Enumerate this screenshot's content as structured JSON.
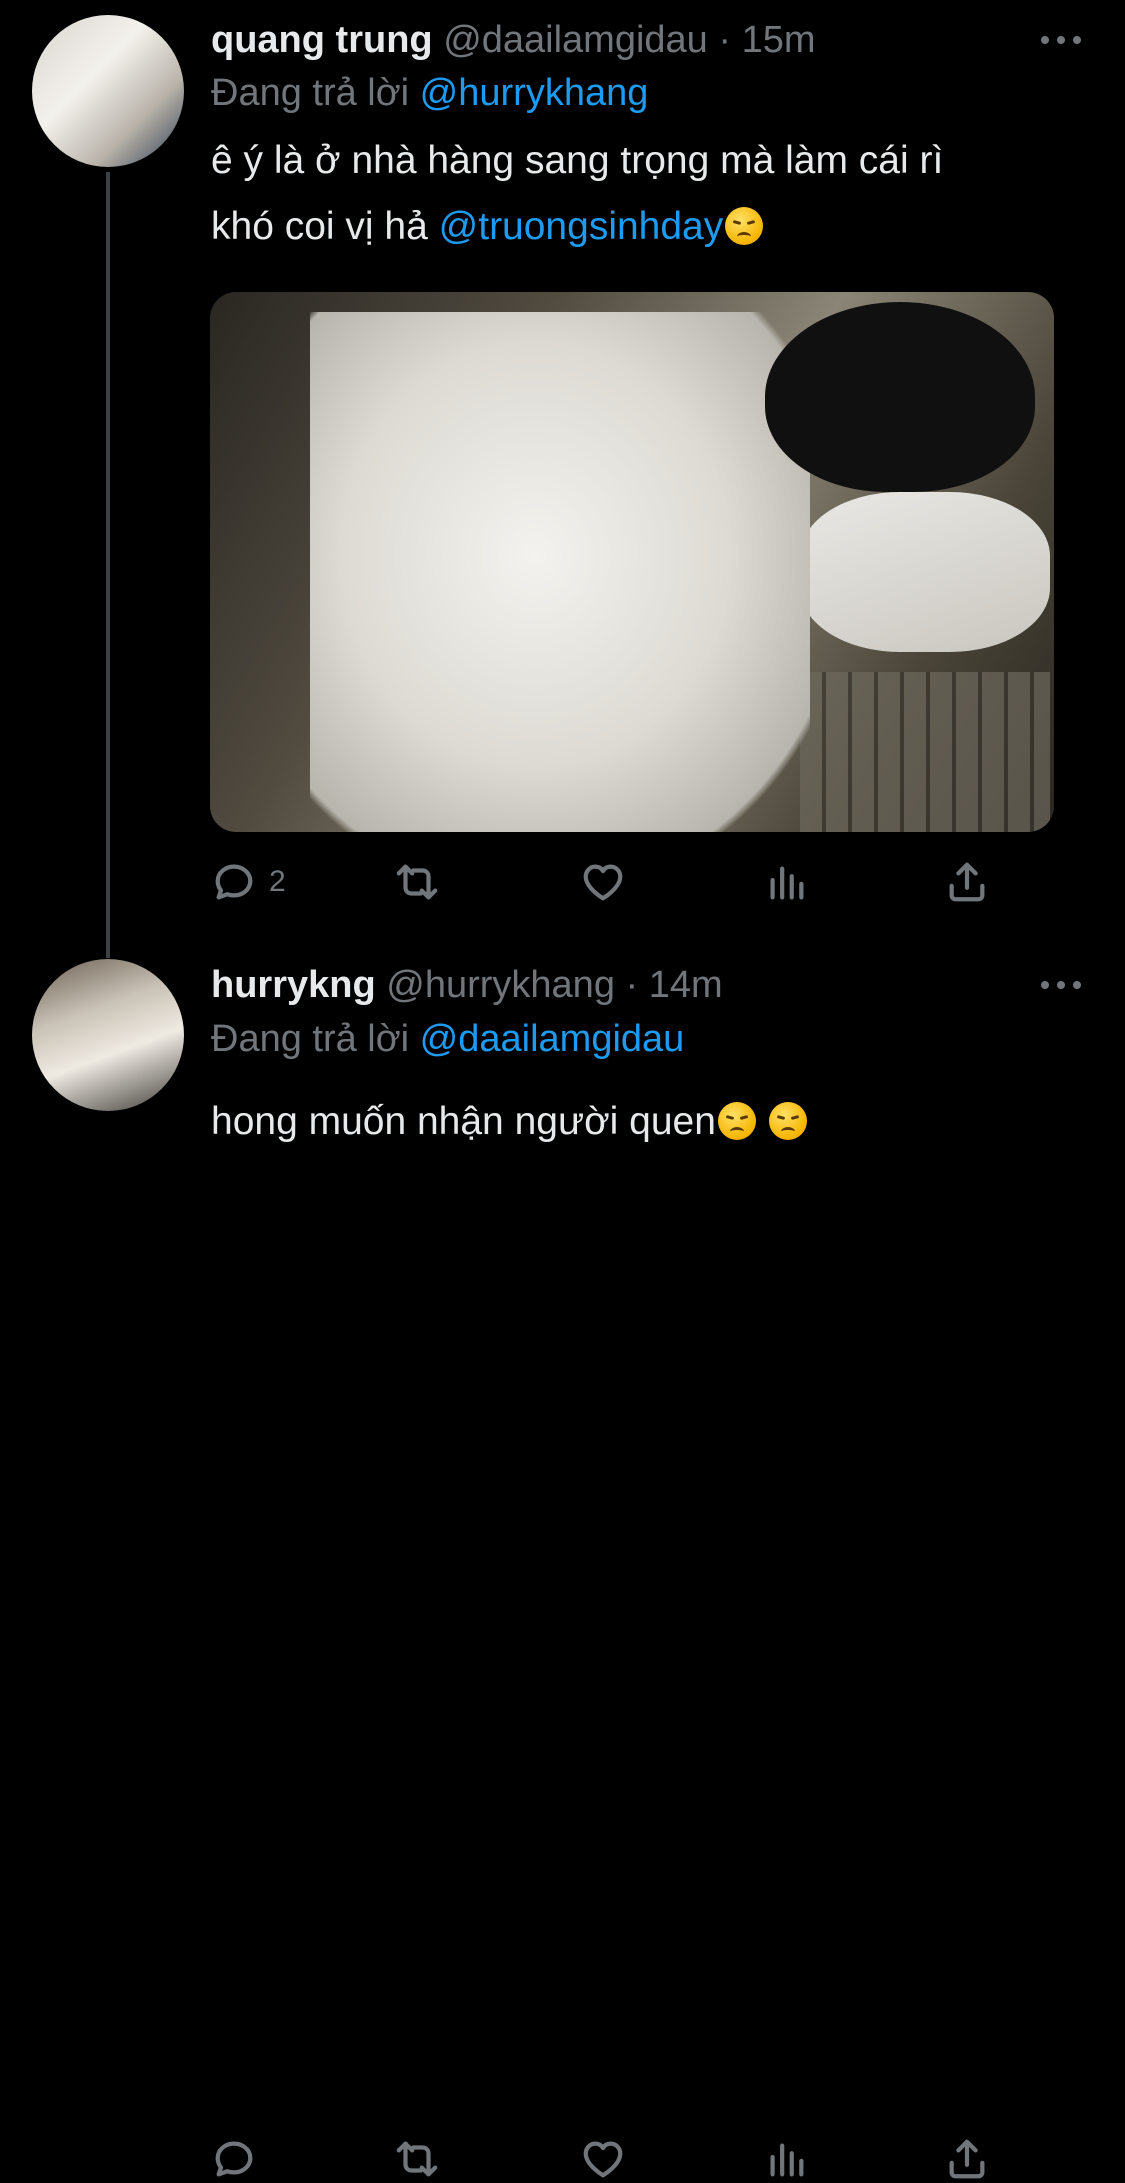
{
  "tweets": [
    {
      "name": "quang trung",
      "handle": "@daailamgidau",
      "separator": "·",
      "time": "15m",
      "reply_prefix": "Đang trả lời",
      "reply_to": "@hurrykhang",
      "text_line1": "ê ý là ở nhà hàng sang trọng mà làm cái rì",
      "text_line2": "khó coi vị hả",
      "text_mention": "@truongsinhday",
      "emojis": [
        "disappointed-face-emoji"
      ],
      "has_media": true,
      "reply_count": "2",
      "icons": [
        "reply-icon",
        "retweet-icon",
        "like-icon",
        "views-icon",
        "share-icon",
        "more-icon"
      ]
    },
    {
      "name": "hurrykng",
      "handle": "@hurrykhang",
      "separator": "·",
      "time": "14m",
      "reply_prefix": "Đang trả lời",
      "reply_to": "@daailamgidau",
      "text": "hong muốn nhận người quen",
      "emojis": [
        "disappointed-face-emoji",
        "disappointed-face-emoji"
      ],
      "reply_count": "",
      "icons": [
        "reply-icon",
        "retweet-icon",
        "like-icon",
        "views-icon",
        "share-icon",
        "more-icon"
      ]
    }
  ],
  "colors": {
    "background": "#000000",
    "text": "#e7e9ea",
    "secondary": "#71767b",
    "accent": "#1d9bf0"
  }
}
